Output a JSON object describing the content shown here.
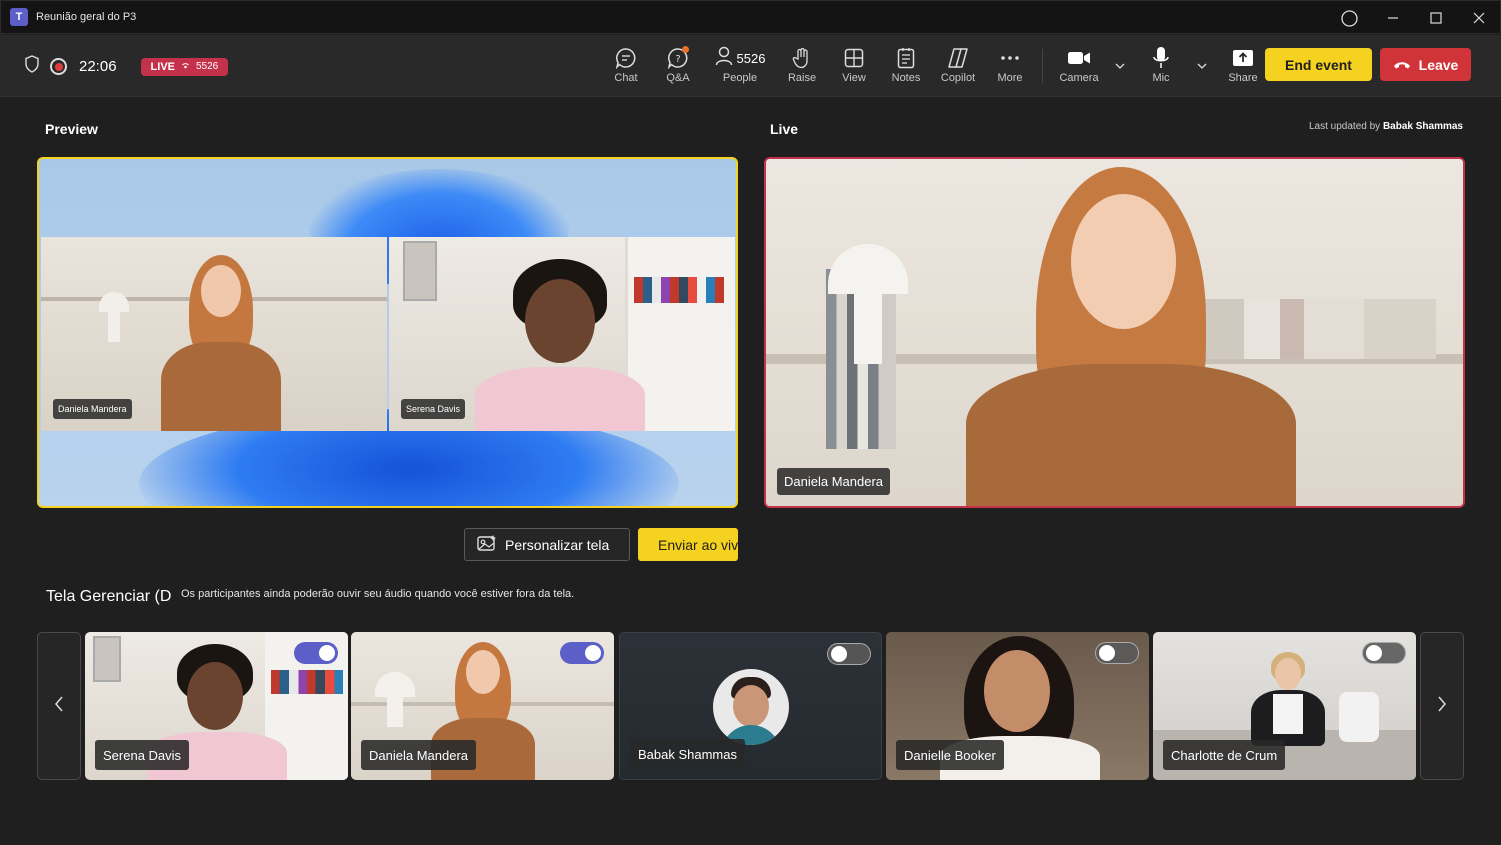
{
  "window": {
    "title": "Reunião geral do P3",
    "app_icon": "teams-icon",
    "controls": [
      "circle-icon",
      "minimize-icon",
      "maximize-icon",
      "close-icon"
    ]
  },
  "toolbar": {
    "timer": "22:06",
    "live_label": "LIVE",
    "live_viewers": "5526",
    "items": {
      "chat": "Chat",
      "qa": "Q&A",
      "people": "People",
      "people_count": "5526",
      "raise": "Raise",
      "view": "View",
      "notes": "Notes",
      "copilot": "Copilot",
      "more": "More",
      "camera": "Camera",
      "mic": "Mic",
      "share": "Share"
    },
    "end_event": "End event",
    "leave": "Leave",
    "colors": {
      "end_event": "#f5d21f",
      "leave": "#d13438",
      "live_badge": "#c4314b"
    }
  },
  "preview": {
    "label": "Preview",
    "tiles": [
      {
        "name": "Daniela Mandera"
      },
      {
        "name": "Serena Davis"
      }
    ],
    "border_color": "#f5d21f"
  },
  "live": {
    "label": "Live",
    "last_updated_prefix": "Last updated by",
    "last_updated_by": "Babak Shammas",
    "speaker": "Daniela Mandera",
    "border_color": "#c4314b"
  },
  "actions": {
    "customize": "Personalizar tela",
    "send_live": "Enviar ao vivo"
  },
  "manage": {
    "title": "Tela Gerenciar (D",
    "note": "Os participantes ainda poderão ouvir seu áudio quando você estiver fora da tela."
  },
  "participants": [
    {
      "name": "Serena Davis",
      "on_screen": true
    },
    {
      "name": "Daniela Mandera",
      "on_screen": true
    },
    {
      "name": "Babak Shammas",
      "on_screen": false
    },
    {
      "name": "Danielle Booker",
      "on_screen": false
    },
    {
      "name": "Charlotte de Crum",
      "on_screen": false
    }
  ]
}
